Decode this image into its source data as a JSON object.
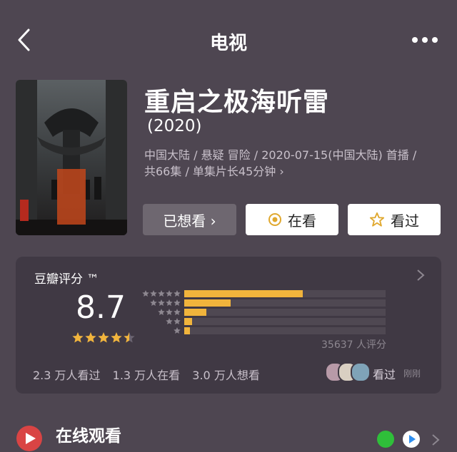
{
  "header": {
    "title": "电视"
  },
  "movie": {
    "title": "重启之极海听雷",
    "year": "(2020)",
    "meta_line1": "中国大陆 / 悬疑 冒险 / 2020-07-15(中国大陆) 首播 /",
    "meta_line2": "共66集 / 单集片长45分钟 ›"
  },
  "actions": {
    "want": "已想看 ›",
    "watching": "在看",
    "watched": "看过"
  },
  "rating": {
    "title": "豆瓣评分 ™",
    "score": "8.7",
    "star_level": 4.5,
    "distribution_percent": [
      59,
      23,
      11,
      4,
      3
    ],
    "raters": "35637 人评分",
    "stats": [
      "2.3 万人看过",
      "1.3 万人在看",
      "3.0 万人想看"
    ],
    "watched_label": "看过",
    "just_now": "刚刚"
  },
  "online": {
    "title": "在线观看"
  },
  "colors": {
    "background": "#4e4651",
    "card": "#403944",
    "accent": "#f1b43c",
    "play": "#d94444"
  }
}
